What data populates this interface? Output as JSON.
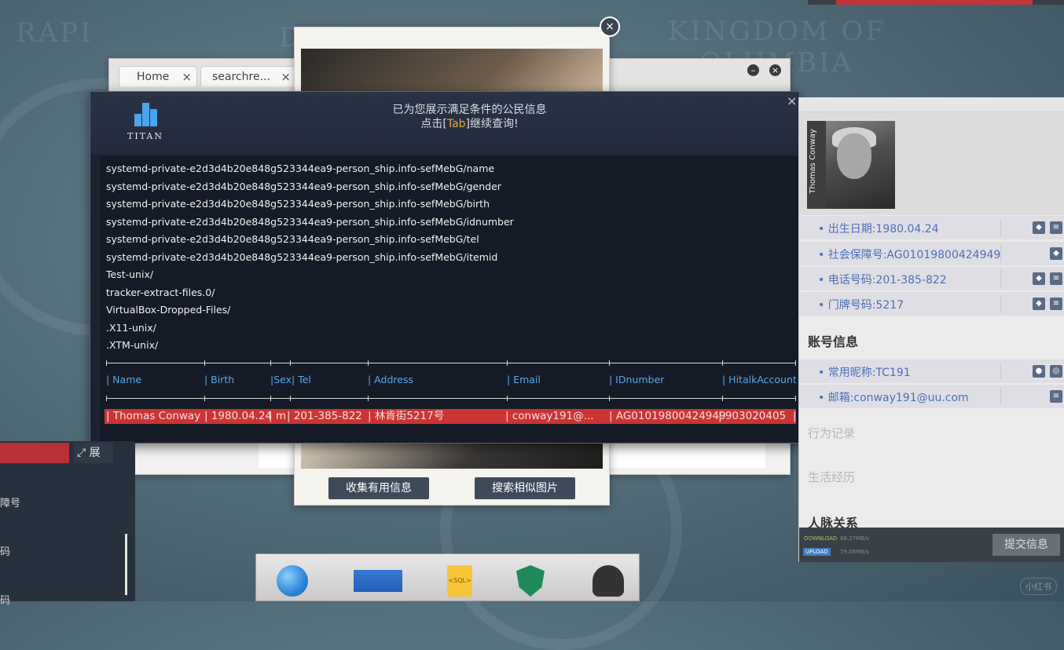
{
  "background": {
    "text_1": "D",
    "text_2": "KINGDOM OF",
    "text_3": "OLUMBIA",
    "text_4": "RAPI"
  },
  "browser": {
    "tabs": [
      {
        "label": "Home"
      },
      {
        "label": "searchre..."
      }
    ],
    "close_glyph": "×"
  },
  "photo_viewer": {
    "collect_button": "收集有用信息",
    "search_button": "搜索相似图片",
    "close_glyph": "×"
  },
  "terminal": {
    "brand": "TITAN",
    "message_line1": "已为您展示满足条件的公民信息",
    "message_line2_pre": "点击[",
    "message_line2_key": "Tab",
    "message_line2_post": "]继续查询!",
    "close_glyph": "×",
    "lines": [
      "systemd-private-e2d3d4b20e848g523344ea9-person_ship.info-sefMebG/name",
      "systemd-private-e2d3d4b20e848g523344ea9-person_ship.info-sefMebG/gender",
      "systemd-private-e2d3d4b20e848g523344ea9-person_ship.info-sefMebG/birth",
      "systemd-private-e2d3d4b20e848g523344ea9-person_ship.info-sefMebG/idnumber",
      "systemd-private-e2d3d4b20e848g523344ea9-person_ship.info-sefMebG/tel",
      "systemd-private-e2d3d4b20e848g523344ea9-person_ship.info-sefMebG/itemid",
      "Test-unix/",
      "tracker-extract-files.0/",
      "VirtualBox-Dropped-Files/",
      ".X11-unix/",
      ".XTM-unix/"
    ],
    "table_headers": [
      "| Name",
      "| Birth",
      "|Sex| Tel",
      "| Address",
      "| Email",
      "| IDnumber",
      "| HitalkAccount |"
    ],
    "table_row": [
      "| Thomas Conway",
      "| 1980.04.24",
      "| m",
      "| 201-385-822",
      "| 林肯街5217号",
      "| conway191@...",
      "| AG01019800424949",
      "| 903020405",
      "|"
    ]
  },
  "profile": {
    "name_tag": "Thomas Conway",
    "rows": [
      "• 出生日期:1980.04.24",
      "• 社会保障号:AG01019800424949",
      "• 电话号码:201-385-822",
      "• 门牌号码:5217"
    ],
    "account_section": "账号信息",
    "account_rows": [
      "• 常用昵称:TC191",
      "• 邮箱:conway191@uu.com"
    ],
    "behavior_section": "行为记录",
    "life_section": "生活经历",
    "relations_section": "人脉关系",
    "download_label": "DOWNLOAD",
    "download_speed": "66.27MB/s",
    "upload_label": "UPLOAD",
    "upload_speed": "79.08MB/s",
    "submit_button": "提交信息"
  },
  "left_panel": {
    "expand_label": "展",
    "item_1": "障号",
    "item_2": "码",
    "item_3": "码"
  },
  "dock": {
    "apps": [
      "browser-globe",
      "mail",
      "sql-file",
      "security-shield",
      "hacker-hat"
    ],
    "sql_label": "<SQL>"
  },
  "watermark": "小红书"
}
